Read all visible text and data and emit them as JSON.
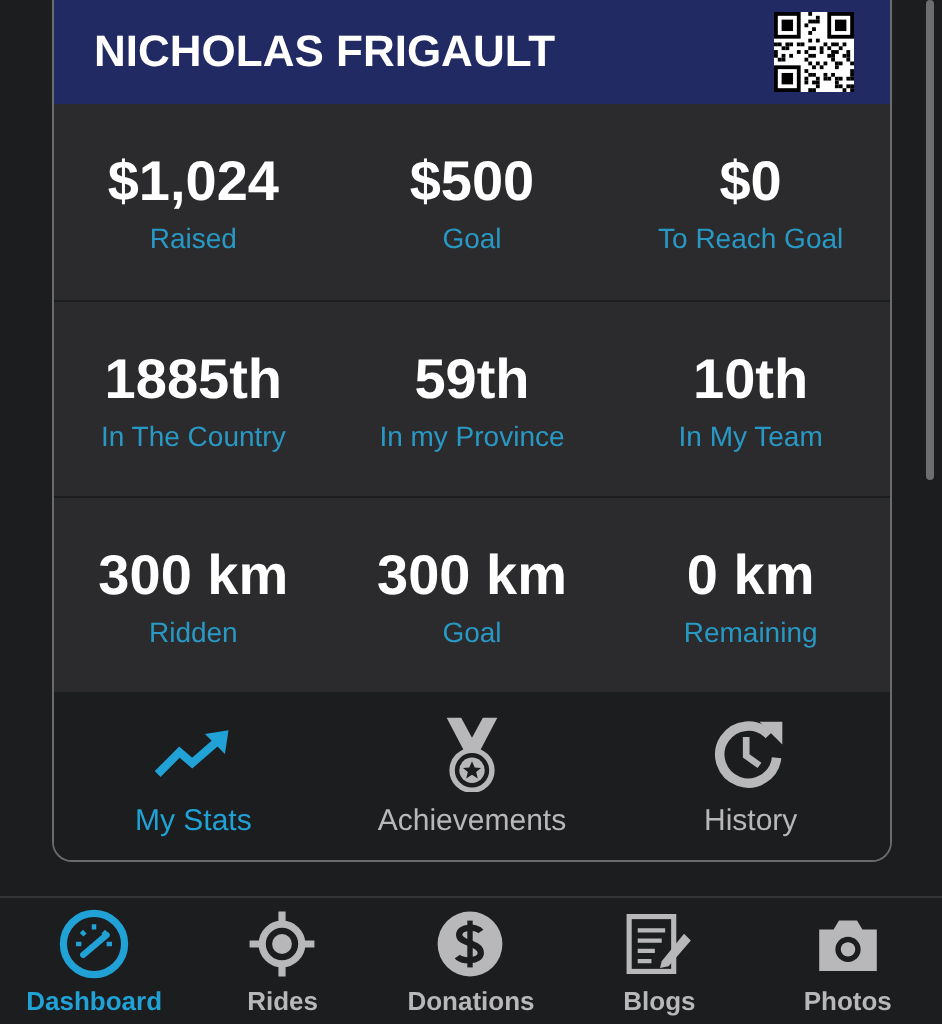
{
  "profile": {
    "name": "NICHOLAS FRIGAULT"
  },
  "stat_rows": [
    {
      "stats": [
        {
          "value": "$1,024",
          "label": "Raised"
        },
        {
          "value": "$500",
          "label": "Goal"
        },
        {
          "value": "$0",
          "label": "To Reach Goal"
        }
      ]
    },
    {
      "stats": [
        {
          "value": "1885th",
          "label": "In The Country"
        },
        {
          "value": "59th",
          "label": "In my Province"
        },
        {
          "value": "10th",
          "label": "In My Team"
        }
      ]
    },
    {
      "stats": [
        {
          "value": "300 km",
          "label": "Ridden"
        },
        {
          "value": "300 km",
          "label": "Goal"
        },
        {
          "value": "0 km",
          "label": "Remaining"
        }
      ]
    }
  ],
  "tabs": [
    {
      "label": "My Stats",
      "kind": "trend",
      "selected": true
    },
    {
      "label": "Achievements",
      "kind": "medal",
      "selected": false
    },
    {
      "label": "History",
      "kind": "history",
      "selected": false
    }
  ],
  "bottom_nav": [
    {
      "label": "Dashboard",
      "kind": "gauge",
      "selected": true
    },
    {
      "label": "Rides",
      "kind": "target",
      "selected": false
    },
    {
      "label": "Donations",
      "kind": "dollar",
      "selected": false
    },
    {
      "label": "Blogs",
      "kind": "blog",
      "selected": false
    },
    {
      "label": "Photos",
      "kind": "camera",
      "selected": false
    }
  ]
}
